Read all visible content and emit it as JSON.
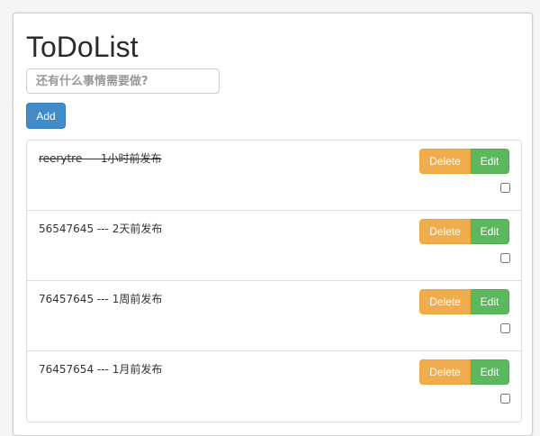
{
  "app": {
    "title": "ToDoList"
  },
  "input": {
    "placeholder": "还有什么事情需要做?",
    "value": ""
  },
  "add_button": {
    "label": "Add"
  },
  "colors": {
    "primary": "#428bca",
    "warning": "#f0ad4e",
    "success": "#5cb85c"
  },
  "todos": [
    {
      "text": "reerytre --- 1小时前发布",
      "done": true,
      "delete_label": "Delete",
      "edit_label": "Edit"
    },
    {
      "text": "56547645 --- 2天前发布",
      "done": false,
      "delete_label": "Delete",
      "edit_label": "Edit"
    },
    {
      "text": "76457645 --- 1周前发布",
      "done": false,
      "delete_label": "Delete",
      "edit_label": "Edit"
    },
    {
      "text": "76457654 --- 1月前发布",
      "done": false,
      "delete_label": "Delete",
      "edit_label": "Edit"
    }
  ]
}
